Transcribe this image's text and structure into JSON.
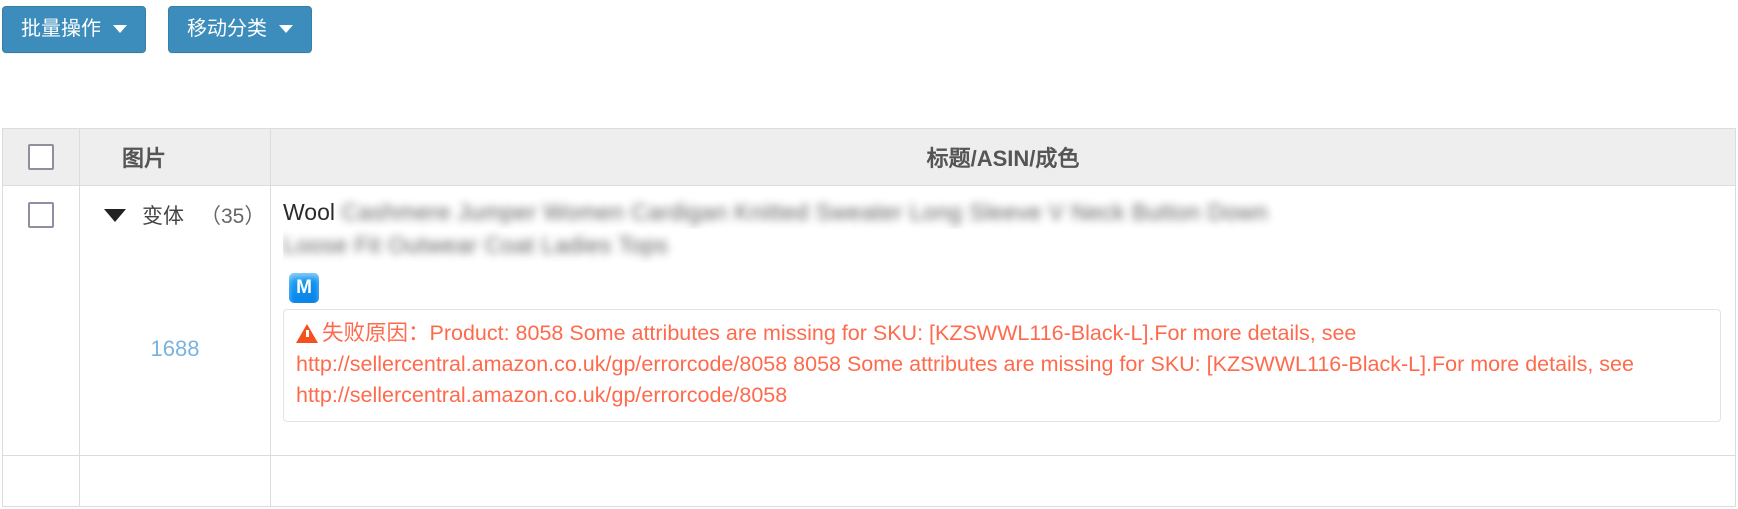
{
  "toolbar": {
    "buttons": [
      {
        "label": "批量操作",
        "icon": "chevron-down-icon"
      },
      {
        "label": "移动分类",
        "icon": "chevron-down-icon"
      }
    ]
  },
  "table": {
    "headers": {
      "select_all": "",
      "image": "图片",
      "title_asin_condition": "标题/ASIN/成色"
    },
    "rows": [
      {
        "selected": false,
        "variant_label": "变体",
        "variant_count": "（35）",
        "source_link": "1688",
        "title_prefix": "Wool",
        "title_blurred_line1": "Cashmere Jumper Women Cardigan Knitted Sweater Long Sleeve V Neck Button Down",
        "title_blurred_line2": "Loose Fit Outwear Coat Ladies Tops",
        "badge": {
          "name": "m-badge",
          "text": "M"
        },
        "error": {
          "icon": "warning-icon",
          "label": "失败原因：",
          "message": "Product: 8058 Some attributes are missing for SKU: [KZSWWL116-Black-L].For more details, see http://sellercentral.amazon.co.uk/gp/errorcode/8058 8058 Some attributes are missing for SKU: [KZSWWL116-Black-L].For more details, see http://sellercentral.amazon.co.uk/gp/errorcode/8058"
        }
      }
    ]
  },
  "colors": {
    "button_blue": "#3c8dbc",
    "link_blue": "#7ab3e0",
    "error_orange": "#ff6a4d",
    "header_gray": "#eeeeee",
    "border_gray": "#dcdcdc"
  }
}
